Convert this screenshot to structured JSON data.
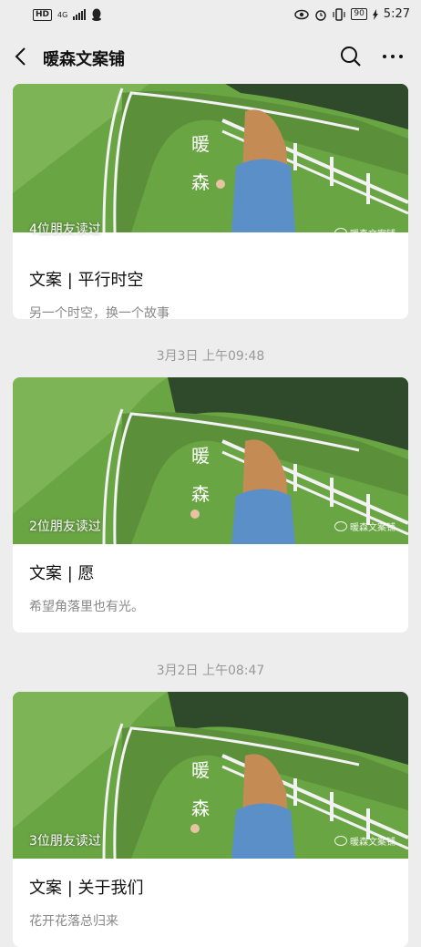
{
  "status_bar": {
    "network": "HD",
    "network_gen": "4G",
    "battery": "90",
    "time": "5:27"
  },
  "header": {
    "title": "暖森文案铺"
  },
  "cover_overlay": {
    "char1": "暖",
    "char2": "森",
    "watermark": "暖森文案铺"
  },
  "posts": [
    {
      "readers": "4位朋友读过",
      "title": "文案 | 平行时空",
      "desc": "另一个时空，换一个故事"
    },
    {
      "date": "3月3日 上午09:48",
      "readers": "2位朋友读过",
      "title": "文案 | 愿",
      "desc": "希望角落里也有光。"
    },
    {
      "date": "3月2日 上午08:47",
      "readers": "3位朋友读过",
      "title": "文案 | 关于我们",
      "desc": "花开花落总归来"
    }
  ],
  "colors": {
    "background": "#ededed",
    "card": "#ffffff",
    "grass": "#6aa544",
    "fence": "#f2f2f2"
  }
}
